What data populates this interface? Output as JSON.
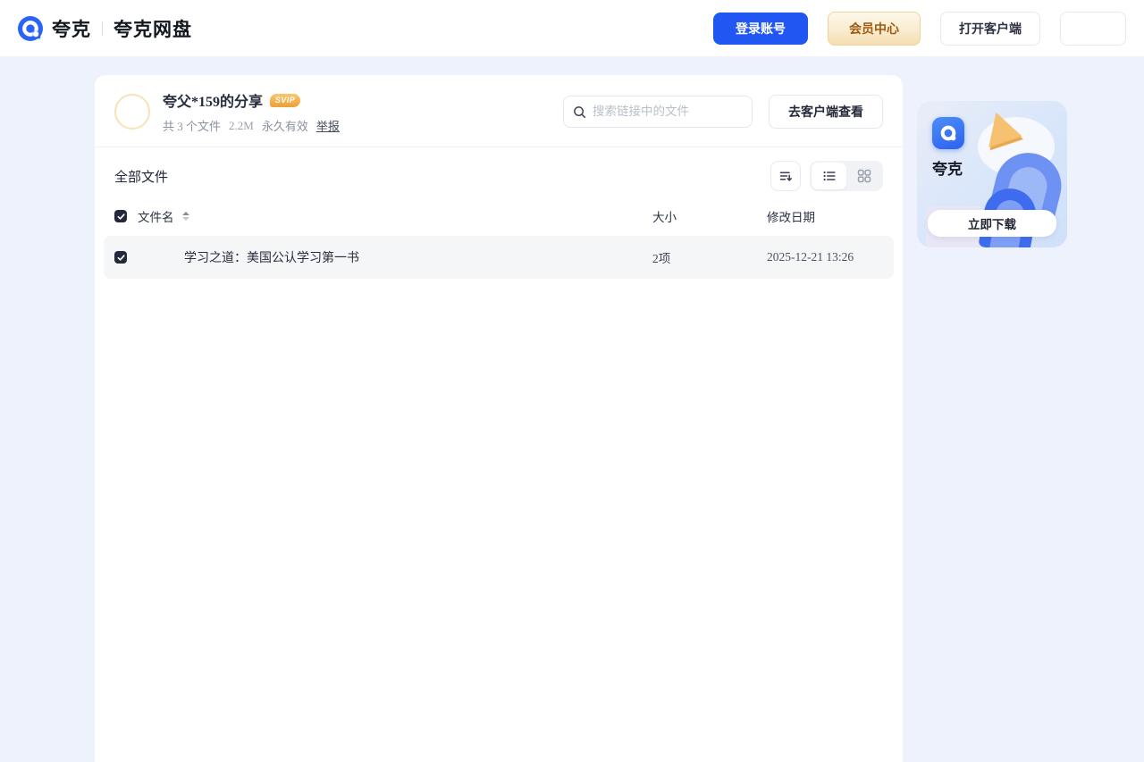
{
  "header": {
    "brand": "夸克",
    "product": "夸克网盘",
    "buttons": {
      "login": "登录账号",
      "vip": "会员中心",
      "open_client": "打开客户端"
    }
  },
  "share": {
    "title": "夸父*159的分享",
    "badge": "SVIP",
    "file_count": "共 3 个文件",
    "total_size": "2.2M",
    "validity": "永久有效",
    "report": "举报",
    "search_placeholder": "搜索链接中的文件",
    "view_in_client": "去客户端查看"
  },
  "files": {
    "section_title": "全部文件",
    "view_mode": "list",
    "select_all_checked": true,
    "columns": {
      "name": "文件名",
      "size": "大小",
      "modified": "修改日期"
    },
    "rows": [
      {
        "name": "学习之道：美国公认学习第一书",
        "size": "2项",
        "modified": "2025-12-21 13:26",
        "checked": true,
        "type": "folder"
      }
    ]
  },
  "promo": {
    "app_name": "夸克",
    "download": "立即下载"
  },
  "icons": {
    "logo": "quark-ring-dot",
    "search": "magnifier",
    "sort": "sort-lines-down-arrow",
    "list_view": "list-bullets",
    "grid_view": "four-squares",
    "name_sort": "up-down-carets",
    "checkbox": "check"
  },
  "colors": {
    "primary_blue": "#2156f2",
    "page_bg": "#edf2fc",
    "vip_text": "#a2580f",
    "badge_gold": "#ef9f36",
    "row_bg": "#f5f6f8"
  }
}
